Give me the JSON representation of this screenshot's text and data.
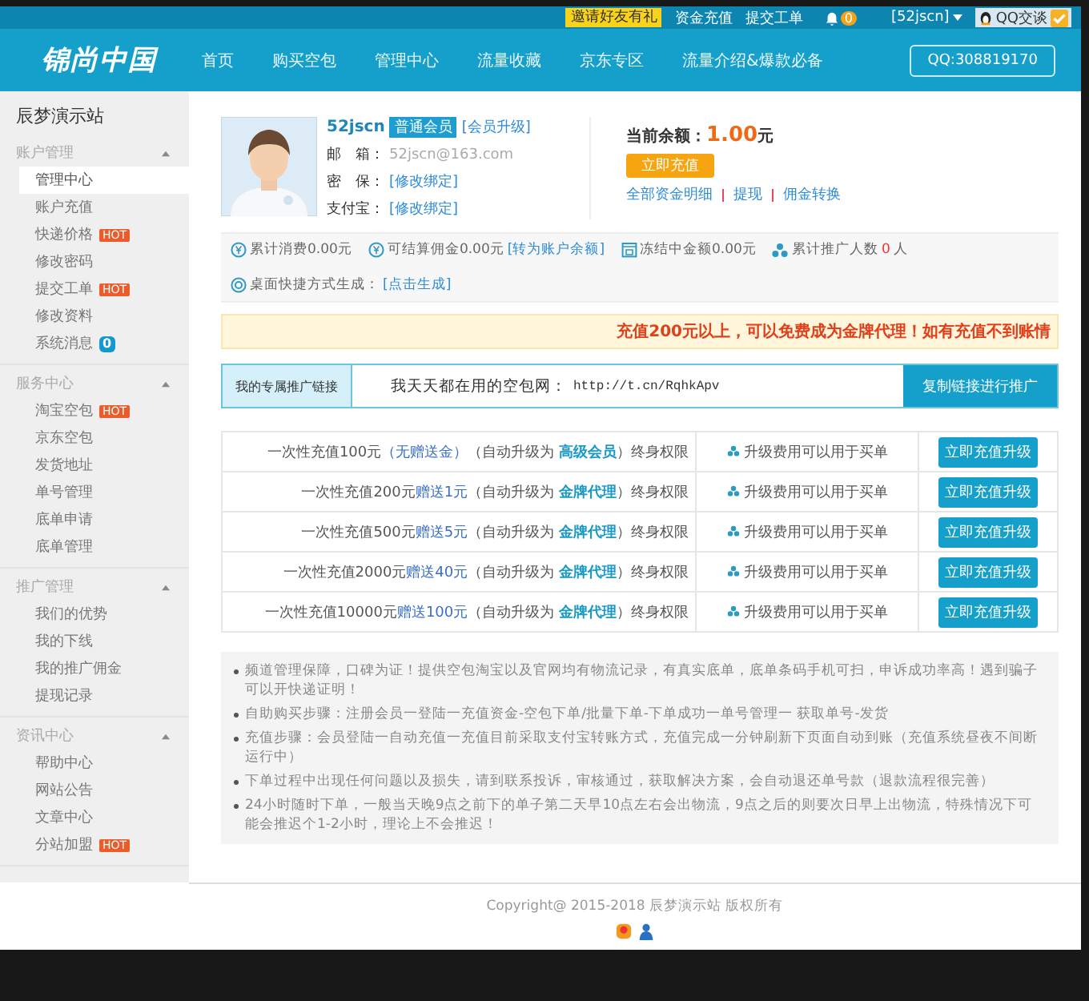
{
  "top_bar": {
    "promo_badge": "邀请好友有礼",
    "links": [
      "资金充值",
      "提交工单"
    ],
    "notification_count": "0",
    "user_menu": "[52jscn]",
    "qq_chat": "QQ交谈"
  },
  "nav": {
    "logo": "锦尚中国",
    "items": [
      {
        "label": "首页",
        "selected": false
      },
      {
        "label": "购买空包",
        "selected": false
      },
      {
        "label": "管理中心",
        "selected": false
      },
      {
        "label": "流量收藏",
        "selected": false
      },
      {
        "label": "京东专区",
        "selected": false
      },
      {
        "label": "流量介绍&爆款必备",
        "selected": false
      }
    ],
    "qq": "QQ:308819170"
  },
  "sidebar": {
    "title": "辰梦演示站",
    "sections": [
      {
        "title": "账户管理",
        "expanded": true,
        "items": [
          {
            "label": "管理中心",
            "selected": true
          },
          {
            "label": "账户充值",
            "selected": false
          },
          {
            "label": "快递价格",
            "selected": false,
            "badge": {
              "kind": "hot",
              "text": "HOT"
            }
          },
          {
            "label": "修改密码",
            "selected": false
          },
          {
            "label": "提交工单",
            "selected": false,
            "badge": {
              "kind": "hot",
              "text": "HOT"
            }
          },
          {
            "label": "修改资料",
            "selected": false
          },
          {
            "label": "系统消息",
            "selected": false,
            "badge": {
              "kind": "count",
              "text": "0"
            }
          }
        ]
      },
      {
        "title": "服务中心",
        "expanded": true,
        "items": [
          {
            "label": "淘宝空包",
            "selected": false,
            "badge": {
              "kind": "hot",
              "text": "HOT"
            }
          },
          {
            "label": "京东空包",
            "selected": false
          },
          {
            "label": "发货地址",
            "selected": false
          },
          {
            "label": "单号管理",
            "selected": false
          },
          {
            "label": "底单申请",
            "selected": false
          },
          {
            "label": "底单管理",
            "selected": false
          }
        ]
      },
      {
        "title": "推广管理",
        "expanded": true,
        "items": [
          {
            "label": "我们的优势",
            "selected": false
          },
          {
            "label": "我的下线",
            "selected": false
          },
          {
            "label": "我的推广佣金",
            "selected": false
          },
          {
            "label": "提现记录",
            "selected": false
          }
        ]
      },
      {
        "title": "资讯中心",
        "expanded": true,
        "items": [
          {
            "label": "帮助中心",
            "selected": false
          },
          {
            "label": "网站公告",
            "selected": false
          },
          {
            "label": "文章中心",
            "selected": false
          },
          {
            "label": "分站加盟",
            "selected": false,
            "badge": {
              "kind": "hot",
              "text": "HOT"
            }
          }
        ]
      }
    ]
  },
  "profile": {
    "username": "52jscn",
    "member_level": "普通会员",
    "upgrade_link": "[会员升级]",
    "fields": [
      {
        "label": "邮　箱：",
        "value": "52jscn@163.com",
        "kind": "text"
      },
      {
        "label": "密　保：",
        "value": "[修改绑定]",
        "kind": "link"
      },
      {
        "label": "支付宝：",
        "value": "[修改绑定]",
        "kind": "link"
      }
    ],
    "balance_label": "当前余额：",
    "balance": "1.00",
    "balance_unit": "元",
    "recharge_button": "立即充值",
    "links": [
      "全部资金明细",
      "提现",
      "佣金转换"
    ]
  },
  "stats": [
    {
      "text": "累计消费0.00元"
    },
    {
      "text": "可结算佣金0.00元",
      "link": "[转为账户余额]"
    },
    {
      "text": "冻结中金额0.00元"
    },
    {
      "text": "累计推广人数",
      "count": "0",
      "unit": "人"
    },
    {
      "text": "桌面快捷方式生成：",
      "link": "[点击生成]"
    }
  ],
  "notice": "充值200元以上，可以免费成为金牌代理！如有充值不到账情",
  "promo_link": {
    "label": "我的专属推广链接",
    "text": "我天天都在用的空包网：",
    "url": "http://t.cn/RqhkApv",
    "button": "复制链接进行推广"
  },
  "upgrade_rows": [
    {
      "amount": "一次性充值100元",
      "bonus": "（无赠送金）",
      "upgrade": "（自动升级为",
      "level": "高级会员",
      "suffix": "）终身权限",
      "benefit": "升级费用可以用于买单",
      "button": "立即充值升级"
    },
    {
      "amount": "一次性充值200元",
      "bonus": "赠送1元",
      "upgrade": "（自动升级为",
      "level": "金牌代理",
      "suffix": "）终身权限",
      "benefit": "升级费用可以用于买单",
      "button": "立即充值升级"
    },
    {
      "amount": "一次性充值500元",
      "bonus": "赠送5元",
      "upgrade": "（自动升级为",
      "level": "金牌代理",
      "suffix": "）终身权限",
      "benefit": "升级费用可以用于买单",
      "button": "立即充值升级"
    },
    {
      "amount": "一次性充值2000元",
      "bonus": "赠送40元",
      "upgrade": "（自动升级为",
      "level": "金牌代理",
      "suffix": "）终身权限",
      "benefit": "升级费用可以用于买单",
      "button": "立即充值升级"
    },
    {
      "amount": "一次性充值10000元",
      "bonus": "赠送100元",
      "upgrade": "（自动升级为",
      "level": "金牌代理",
      "suffix": "）终身权限",
      "benefit": "升级费用可以用于买单",
      "button": "立即充值升级"
    }
  ],
  "notes": [
    "频道管理保障，口碑为证！提供空包淘宝以及官网均有物流记录，有真实底单，底单条码手机可扫，申诉成功率高！遇到骗子可以开快递证明！",
    "自助购买步骤：注册会员一登陆一充值资金-空包下单/批量下单-下单成功一单号管理一 获取单号-发货",
    "充值步骤：会员登陆一自动充值一充值目前采取支付宝转账方式，充值完成一分钟刷新下页面自动到账（充值系统昼夜不间断运行中）",
    "下单过程中出现任何问题以及损失，请到联系投诉，审核通过，获取解决方案，会自动退还单号款（退款流程很完善）",
    "24小时随时下单，一般当天晚9点之前下的单子第二天早10点左右会出物流，9点之后的则要次日早上出物流，特殊情况下可能会推迟个1-2小时，理论上不会推迟！"
  ],
  "footer": {
    "copyright": "Copyright@ 2015-2018 辰梦演示站 版权所有"
  }
}
